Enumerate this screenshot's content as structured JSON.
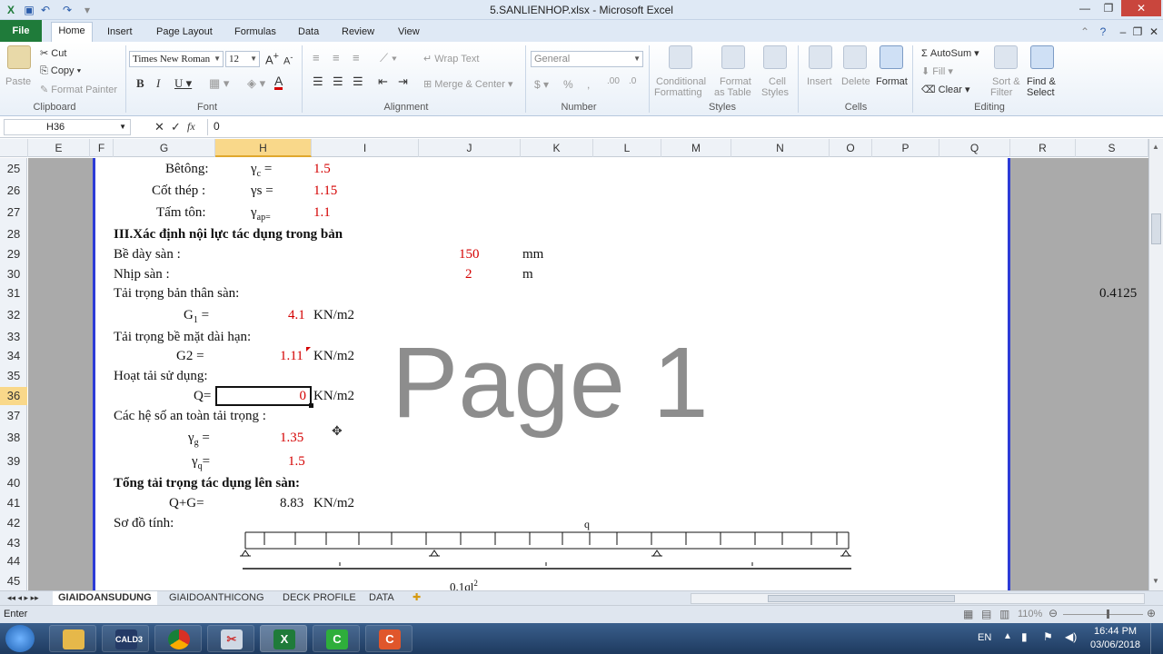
{
  "window": {
    "title": "5.SANLIENHOP.xlsx  -  Microsoft Excel"
  },
  "ribbon_tabs": [
    "File",
    "Home",
    "Insert",
    "Page Layout",
    "Formulas",
    "Data",
    "Review",
    "View"
  ],
  "clipboard": {
    "paste": "Paste",
    "cut": "Cut",
    "copy": "Copy",
    "format_painter": "Format Painter",
    "label": "Clipboard"
  },
  "font": {
    "name": "Times New Roman",
    "size": "12",
    "label": "Font"
  },
  "alignment": {
    "wrap_text": "Wrap Text",
    "merge_center": "Merge & Center",
    "label": "Alignment"
  },
  "number": {
    "format": "General",
    "label": "Number"
  },
  "styles": {
    "conditional": "Conditional",
    "conditional2": "Formatting",
    "format_as": "Format",
    "format_as2": "as Table",
    "cell": "Cell",
    "cell2": "Styles",
    "label": "Styles"
  },
  "cells": {
    "insert": "Insert",
    "delete": "Delete",
    "format": "Format",
    "label": "Cells"
  },
  "editing": {
    "autosum": "AutoSum",
    "fill": "Fill",
    "clear": "Clear",
    "sort": "Sort &",
    "sort2": "Filter",
    "find": "Find &",
    "find2": "Select",
    "label": "Editing"
  },
  "formula_bar": {
    "name_box": "H36",
    "formula": "0"
  },
  "columns": [
    "E",
    "F",
    "G",
    "H",
    "I",
    "J",
    "K",
    "L",
    "M",
    "N",
    "O",
    "P",
    "Q",
    "R",
    "S"
  ],
  "rows": [
    "25",
    "26",
    "27",
    "28",
    "29",
    "30",
    "31",
    "32",
    "33",
    "34",
    "35",
    "36",
    "37",
    "38",
    "39",
    "40",
    "41",
    "42",
    "43",
    "44",
    "45"
  ],
  "cells_content": {
    "r25_label": "Bêtông:",
    "r25_sym": "γ",
    "r25_sub": "c",
    "r25_eq": " =",
    "r25_val": "1.5",
    "r26_label": "Cốt thép :",
    "r26_sym": "γs =",
    "r26_val": "1.15",
    "r27_label": "Tấm tôn:",
    "r27_sym": "γ",
    "r27_sub": "ap=",
    "r27_val": "1.1",
    "r28": "III.Xác định nội lực tác dụng trong bản",
    "r29_label": "Bề dày sàn :",
    "r29_val": "150",
    "r29_unit": "mm",
    "r30_label": "Nhịp sàn :",
    "r30_val": "2",
    "r30_unit": "m",
    "r31_label": "Tải trọng bản thân sàn:",
    "r31_s": "0.4125",
    "r32_label": "G",
    "r32_sub": "1",
    "r32_eq": " =",
    "r32_val": "4.1",
    "r32_unit": "KN/m2",
    "r33_label": "Tải trọng bề mặt dài hạn:",
    "r34_label": "G2 =",
    "r34_val": "1.11",
    "r34_unit": "KN/m2",
    "r35_label": "Hoạt tải sử dụng:",
    "r36_label": "Q=",
    "r36_val": "0",
    "r36_unit": "KN/m2",
    "r37_label": "Các hệ số an toàn tải trọng :",
    "r38_sym": "γ",
    "r38_sub": "g",
    "r38_eq": " =",
    "r38_val": "1.35",
    "r39_sym": "γ",
    "r39_sub": "q",
    "r39_eq": "=",
    "r39_val": "1.5",
    "r40": "Tổng tải trọng tác dụng lên sàn:",
    "r41_label": "Q+G=",
    "r41_val": "8.83",
    "r41_unit": "KN/m2",
    "r42_label": "Sơ đồ tính:",
    "diagram_q": "q",
    "diagram_moment": "0.1ql",
    "diagram_moment_sup": "2"
  },
  "watermark": "Page 1",
  "sheet_tabs": [
    "GIAIDOANSUDUNG",
    "GIAIDOANTHICONG",
    "DECK PROFILE",
    "DATA"
  ],
  "status": {
    "mode": "Enter",
    "zoom": "110%"
  },
  "taskbar": {
    "lang": "EN",
    "time": "16:44 PM",
    "date": "03/06/2018",
    "app_cald": "CALD3"
  }
}
